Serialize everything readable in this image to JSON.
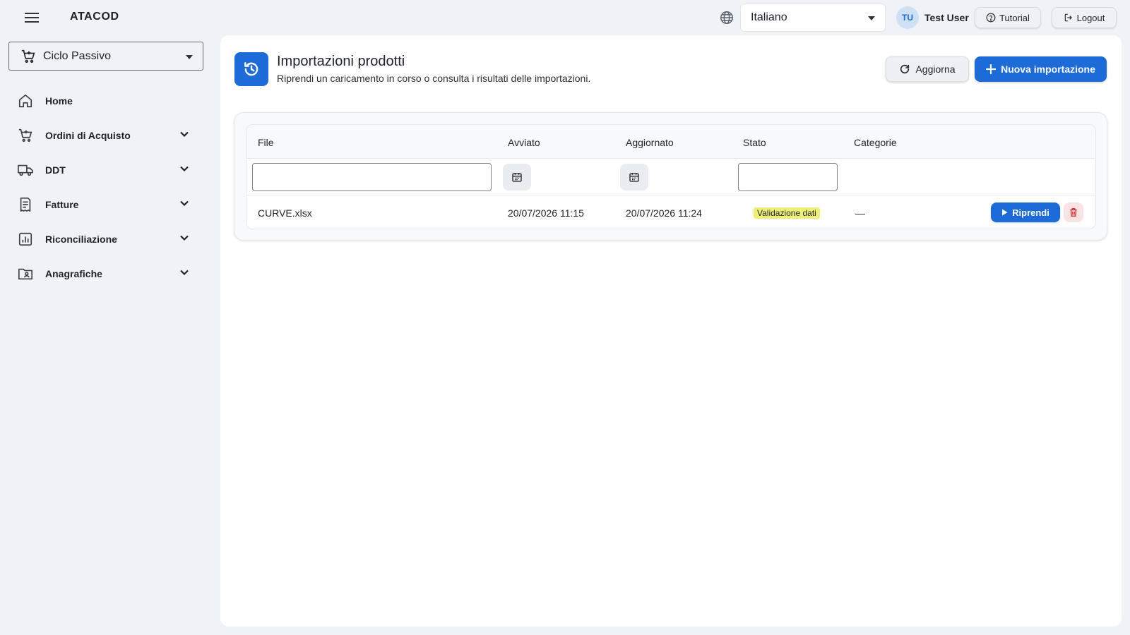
{
  "app": {
    "brand": "ATACOD"
  },
  "topbar": {
    "language": "Italiano",
    "user_initials": "TU",
    "user_name": "Test User",
    "tutorial_label": "Tutorial",
    "logout_label": "Logout"
  },
  "sidebar": {
    "module": "Ciclo Passivo",
    "items": [
      {
        "label": "Home",
        "icon": "home-icon",
        "expandable": false
      },
      {
        "label": "Ordini di Acquisto",
        "icon": "cart-icon",
        "expandable": true
      },
      {
        "label": "DDT",
        "icon": "truck-icon",
        "expandable": true
      },
      {
        "label": "Fatture",
        "icon": "receipt-icon",
        "expandable": true
      },
      {
        "label": "Riconciliazione",
        "icon": "chart-icon",
        "expandable": true
      },
      {
        "label": "Anagrafiche",
        "icon": "contact-folder-icon",
        "expandable": true
      }
    ]
  },
  "page": {
    "title": "Importazioni prodotti",
    "subtitle": "Riprendi un caricamento in corso o consulta i risultati delle importazioni.",
    "refresh_label": "Aggiorna",
    "new_import_label": "Nuova importazione"
  },
  "table": {
    "columns": [
      "File",
      "Avviato",
      "Aggiornato",
      "Stato",
      "Categorie"
    ],
    "filters": {
      "file": "",
      "status": ""
    },
    "rows": [
      {
        "file": "CURVE.xlsx",
        "started": "20/07/2026 11:15",
        "updated": "20/07/2026 11:24",
        "status": "Validazione dati",
        "categories": "—",
        "resume_label": "Riprendi"
      }
    ]
  },
  "colors": {
    "primary": "#1c6bd6",
    "background": "#eff3f8",
    "status_badge": "#ecef7a",
    "delete_bg": "#fbe3e3",
    "delete_icon": "#c62828"
  }
}
